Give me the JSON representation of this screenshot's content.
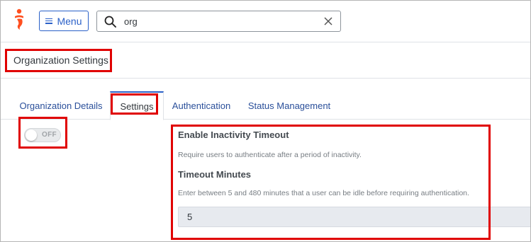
{
  "topbar": {
    "menu_label": "Menu",
    "search_value": "org"
  },
  "page": {
    "title": "Organization Settings"
  },
  "tabs": [
    {
      "label": "Organization Details",
      "active": false
    },
    {
      "label": "Settings",
      "active": true
    },
    {
      "label": "Authentication",
      "active": false
    },
    {
      "label": "Status Management",
      "active": false
    }
  ],
  "settings": {
    "toggle_label": "OFF",
    "inactivity_title": "Enable Inactivity Timeout",
    "inactivity_desc": "Require users to authenticate after a period of inactivity.",
    "timeout_title": "Timeout Minutes",
    "timeout_desc": "Enter between 5 and 480 minutes that a user can be idle before requiring authentication.",
    "timeout_value": "5"
  },
  "colors": {
    "brand": "#ff4f1f",
    "link": "#2a4f9a",
    "accent": "#2a60c8",
    "highlight": "#e00000"
  }
}
